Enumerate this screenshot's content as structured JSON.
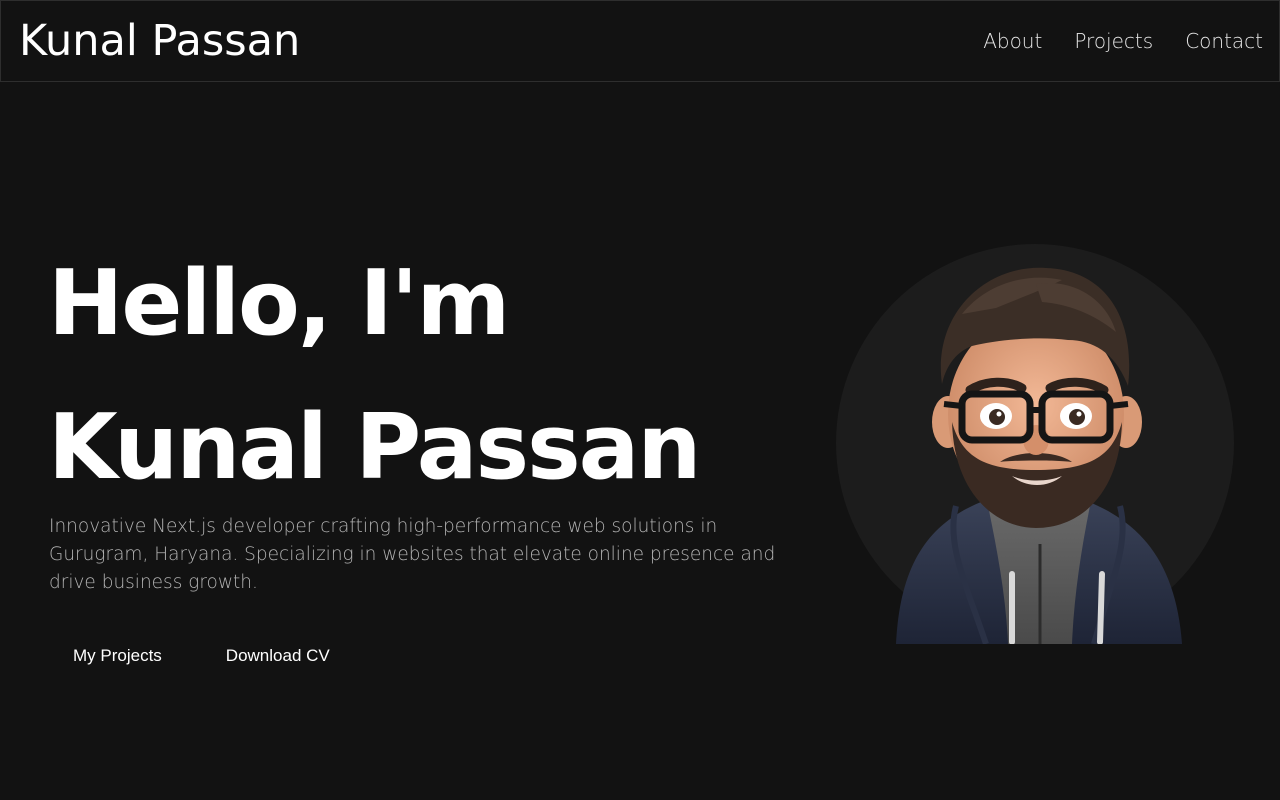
{
  "header": {
    "brand": "Kunal Passan",
    "nav": [
      {
        "label": "About"
      },
      {
        "label": "Projects"
      },
      {
        "label": "Contact"
      }
    ]
  },
  "hero": {
    "line1": "Hello, I'm",
    "line2": "Kunal Passan",
    "description": "Innovative Next.js developer crafting high-performance web solutions in Gurugram, Haryana. Specializing in websites that elevate online presence and drive business growth.",
    "buttons": {
      "projects": "My Projects",
      "cv": "Download CV"
    }
  },
  "colors": {
    "background": "#121212",
    "text": "#ffffff",
    "muted": "#b3b3b3",
    "avatar_circle": "#1c1c1c"
  }
}
